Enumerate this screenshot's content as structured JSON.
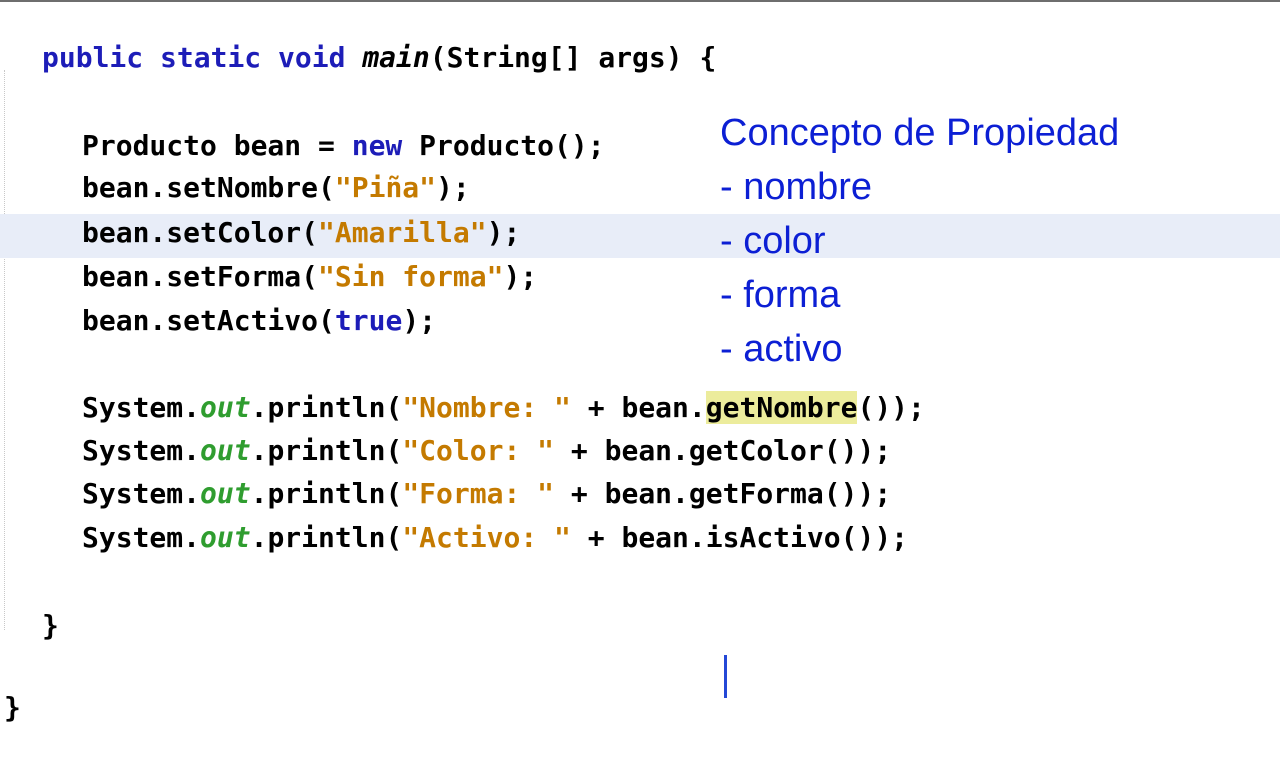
{
  "code": {
    "method_sig": {
      "kw_public": "public",
      "kw_static": "static",
      "kw_void": "void",
      "name": "main",
      "params": "(String[] args) {"
    },
    "line_new": {
      "lhs": "Producto bean = ",
      "kw_new": "new",
      "rhs": " Producto();"
    },
    "line_set_nombre": {
      "call": "bean.setNombre(",
      "arg": "\"Piña\"",
      "end": ");"
    },
    "line_set_color": {
      "call": "bean.setColor(",
      "arg": "\"Amarilla\"",
      "end": ");"
    },
    "line_set_forma": {
      "call": "bean.setForma(",
      "arg": "\"Sin forma\"",
      "end": ");"
    },
    "line_set_activo": {
      "call": "bean.setActivo(",
      "arg": "true",
      "end": ");"
    },
    "print_nombre": {
      "sys": "System.",
      "out": "out",
      "pr": ".println(",
      "str": "\"Nombre: \"",
      "plus": " + bean.",
      "getter": "getNombre",
      "end": "());"
    },
    "print_color": {
      "sys": "System.",
      "out": "out",
      "pr": ".println(",
      "str": "\"Color: \"",
      "plus": " + bean.",
      "getter": "getColor",
      "end": "());"
    },
    "print_forma": {
      "sys": "System.",
      "out": "out",
      "pr": ".println(",
      "str": "\"Forma: \"",
      "plus": " + bean.",
      "getter": "getForma",
      "end": "());"
    },
    "print_activo": {
      "sys": "System.",
      "out": "out",
      "pr": ".println(",
      "str": "\"Activo: \"",
      "plus": " + bean.",
      "getter": "isActivo",
      "end": "());"
    },
    "close_method": "}",
    "close_class": "}"
  },
  "annotation": {
    "title": "Concepto de Propiedad",
    "items": [
      "- nombre",
      "- color",
      "- forma",
      "- activo"
    ],
    "color": "#0c1fd4"
  },
  "colors": {
    "keyword": "#1d1db8",
    "string": "#c47a00",
    "static_field": "#2f9d2f",
    "current_line": "#e8edf8",
    "occurrence_highlight": "#ecec9c"
  }
}
